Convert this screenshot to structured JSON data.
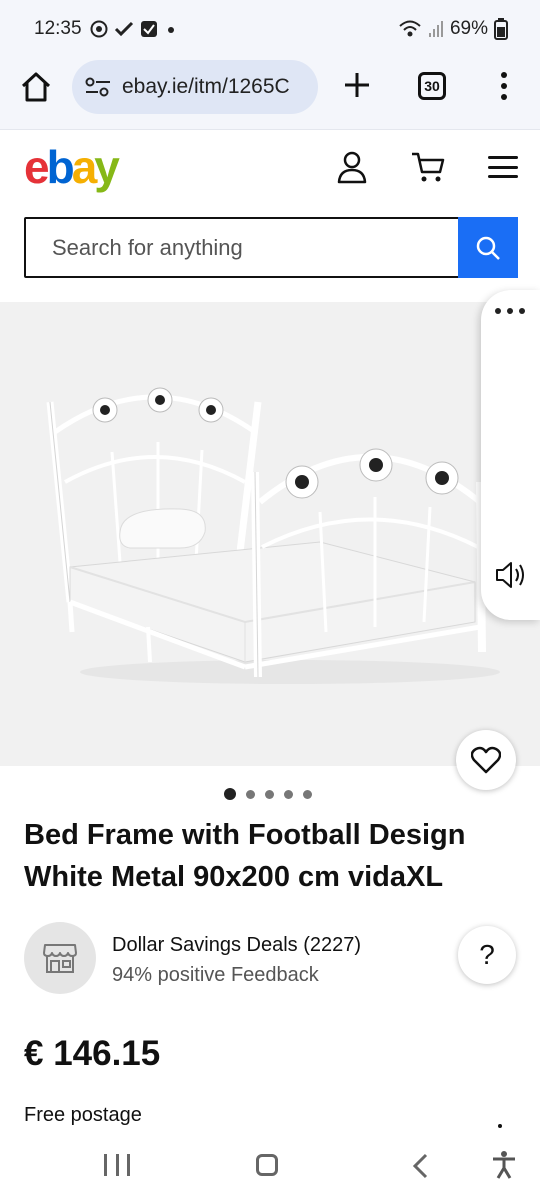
{
  "status_bar": {
    "time": "12:35",
    "battery": "69%"
  },
  "browser": {
    "url": "ebay.ie/itm/1265C",
    "tab_count": "30"
  },
  "header": {
    "logo": [
      "e",
      "b",
      "a",
      "y"
    ],
    "logo_colors": [
      "#e53238",
      "#0064d2",
      "#f5af02",
      "#86b817"
    ]
  },
  "search": {
    "placeholder": "Search for anything",
    "button_color": "#1a6ef5"
  },
  "gallery": {
    "image_count": 5,
    "active_index": 0
  },
  "product": {
    "title": "Bed Frame with Football Design White Metal 90x200 cm vidaXL",
    "price": "€ 146.15",
    "postage": "Free postage"
  },
  "seller": {
    "name": "Dollar Savings Deals (2227)",
    "feedback": "94% positive Feedback"
  },
  "help_label": "?"
}
